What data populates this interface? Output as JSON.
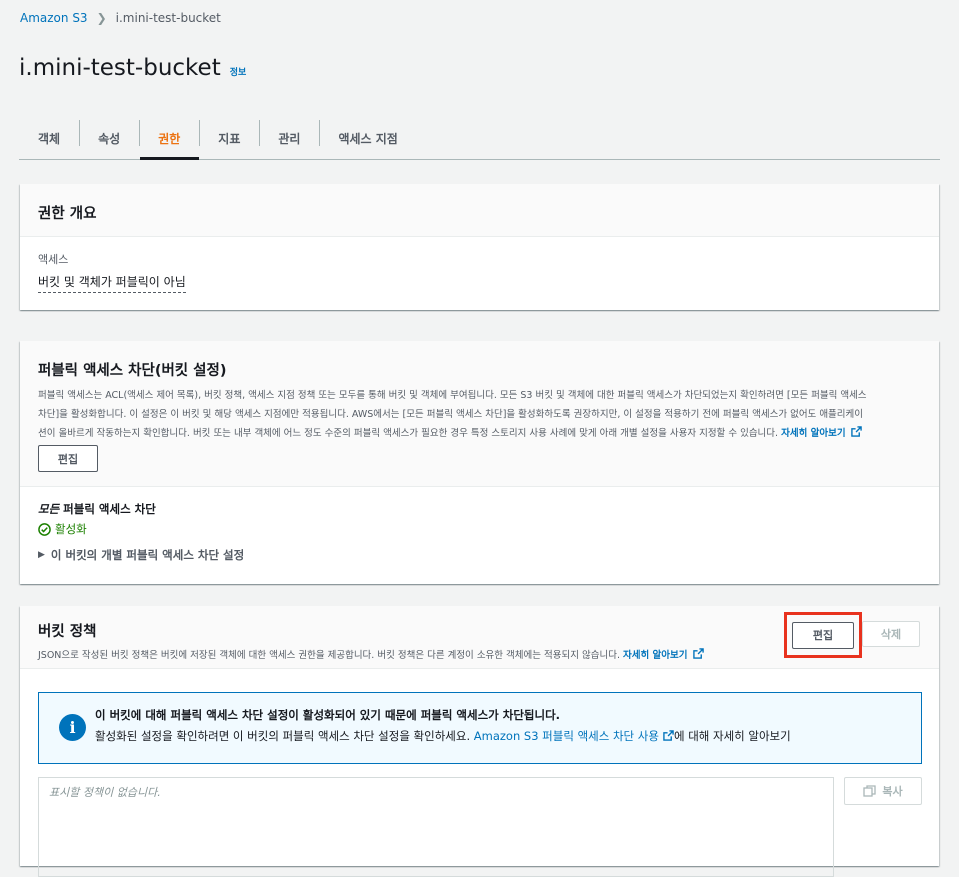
{
  "breadcrumb": {
    "root": "Amazon S3",
    "current": "i.mini-test-bucket"
  },
  "page": {
    "title": "i.mini-test-bucket",
    "info": "정보"
  },
  "tabs": [
    {
      "label": "객체"
    },
    {
      "label": "속성"
    },
    {
      "label": "권한",
      "active": true
    },
    {
      "label": "지표"
    },
    {
      "label": "관리"
    },
    {
      "label": "액세스 지점"
    }
  ],
  "overview": {
    "title": "권한 개요",
    "access_label": "액세스",
    "access_value": "버킷 및 객체가 퍼블릭이 아님"
  },
  "bpa": {
    "title": "퍼블릭 액세스 차단(버킷 설정)",
    "desc_1": "퍼블릭 액세스는 ACL(액세스 제어 목록), 버킷 정책, 액세스 지점 정책 또는 모두를 통해 버킷 및 객체에 부여됩니다. 모든 S3 버킷 및 객체에 대한 퍼블릭 액세스가 차단되었는지 확인하려면 [모든 퍼블릭 액세스",
    "desc_2": "차단]을 활성화합니다. 이 설정은 이 버킷 및 해당 액세스 지점에만 적용됩니다. AWS에서는 [모든 퍼블릭 액세스 차단]을 활성화하도록 권장하지만, 이 설정을 적용하기 전에 퍼블릭 액세스가 없어도 애플리케이",
    "desc_3": "션이 올바르게 작동하는지 확인합니다. 버킷 또는 내부 객체에 어느 정도 수준의 퍼블릭 액세스가 필요한 경우 특정 스토리지 사용 사례에 맞게 아래 개별 설정을 사용자 지정할 수 있습니다.",
    "learn_more": "자세히 알아보기",
    "edit_label": "편집",
    "setting_title_em": "모든",
    "setting_title_rest": " 퍼블릭 액세스 차단",
    "status": "활성화",
    "expander": "이 버킷의 개별 퍼블릭 액세스 차단 설정"
  },
  "policy": {
    "title": "버킷 정책",
    "desc": "JSON으로 작성된 버킷 정책은 버킷에 저장된 객체에 대한 액세스 권한을 제공합니다. 버킷 정책은 다른 계정이 소유한 객체에는 적용되지 않습니다.",
    "learn_more": "자세히 알아보기",
    "edit_label": "편집",
    "delete_label": "삭제",
    "alert_title": "이 버킷에 대해 퍼블릭 액세스 차단 설정이 활성화되어 있기 때문에 퍼블릭 액세스가 차단됩니다.",
    "alert_prefix": "활성화된 설정을 확인하려면 이 버킷의 퍼블릭 액세스 차단 설정을 확인하세요.",
    "alert_link": "Amazon S3 퍼블릭 액세스 차단 사용",
    "alert_suffix": "에 대해 자세히 알아보기",
    "editor_placeholder": "표시할 정책이 없습니다.",
    "copy_label": "복사"
  },
  "colors": {
    "accent": "#ec7211",
    "link": "#0073bb",
    "success": "#1d8102",
    "highlight": "#e8321e"
  }
}
